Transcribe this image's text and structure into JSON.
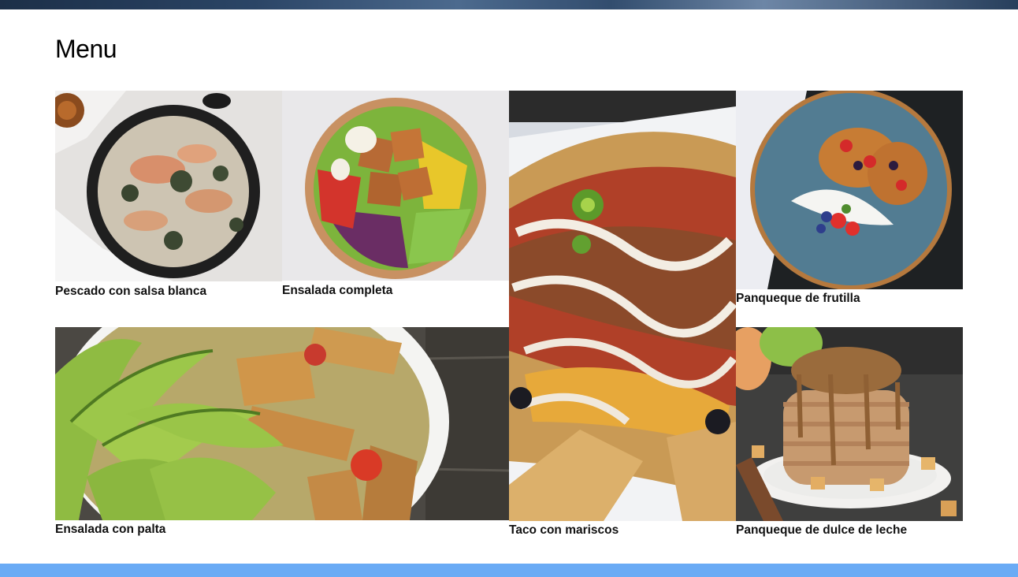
{
  "page": {
    "title": "Menu"
  },
  "menu": {
    "items": [
      {
        "name": "Pescado con salsa blanca",
        "image": "fish-in-skillet"
      },
      {
        "name": "Ensalada completa",
        "image": "salad-bowl"
      },
      {
        "name": "Taco con mariscos",
        "image": "nachos-plate"
      },
      {
        "name": "Panqueque de frutilla",
        "image": "strawberry-pancakes"
      },
      {
        "name": "Ensalada con palta",
        "image": "avocado-salad"
      },
      {
        "name": "Panqueque de dulce de leche",
        "image": "caramel-pancake-stack"
      }
    ]
  },
  "colors": {
    "footer_bar": "#6aabf5",
    "banner": "#2b4566"
  }
}
